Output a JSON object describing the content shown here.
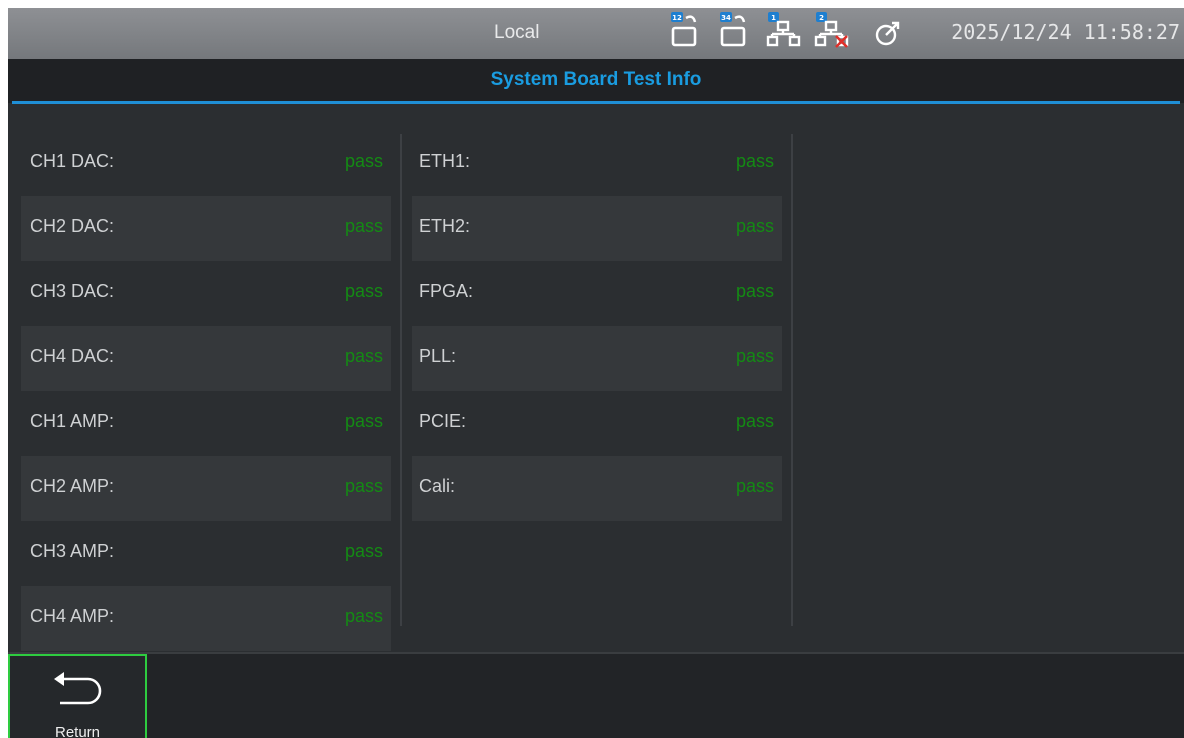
{
  "statusbar": {
    "mode": "Local",
    "icons": [
      "lock-12-icon",
      "lock-34-icon",
      "network-1-icon",
      "network-2-disconnected-icon",
      "target-icon"
    ],
    "datetime": "2025/12/24 11:58:27"
  },
  "header": {
    "title": "System Board Test Info"
  },
  "tests": {
    "left": [
      {
        "label": "CH1 DAC:",
        "value": "pass"
      },
      {
        "label": "CH2 DAC:",
        "value": "pass"
      },
      {
        "label": "CH3 DAC:",
        "value": "pass"
      },
      {
        "label": "CH4 DAC:",
        "value": "pass"
      },
      {
        "label": "CH1 AMP:",
        "value": "pass"
      },
      {
        "label": "CH2 AMP:",
        "value": "pass"
      },
      {
        "label": "CH3 AMP:",
        "value": "pass"
      },
      {
        "label": "CH4 AMP:",
        "value": "pass"
      }
    ],
    "right": [
      {
        "label": "ETH1:",
        "value": "pass"
      },
      {
        "label": "ETH2:",
        "value": "pass"
      },
      {
        "label": "FPGA:",
        "value": "pass"
      },
      {
        "label": "PLL:",
        "value": "pass"
      },
      {
        "label": "PCIE:",
        "value": "pass"
      },
      {
        "label": "Cali:",
        "value": "pass"
      }
    ]
  },
  "footer": {
    "return_label": "Return",
    "return_icon": "return-arrow-icon"
  },
  "colors": {
    "accent": "#1a9ce0",
    "pass": "#148a14",
    "selected_border": "#2ecc40"
  }
}
